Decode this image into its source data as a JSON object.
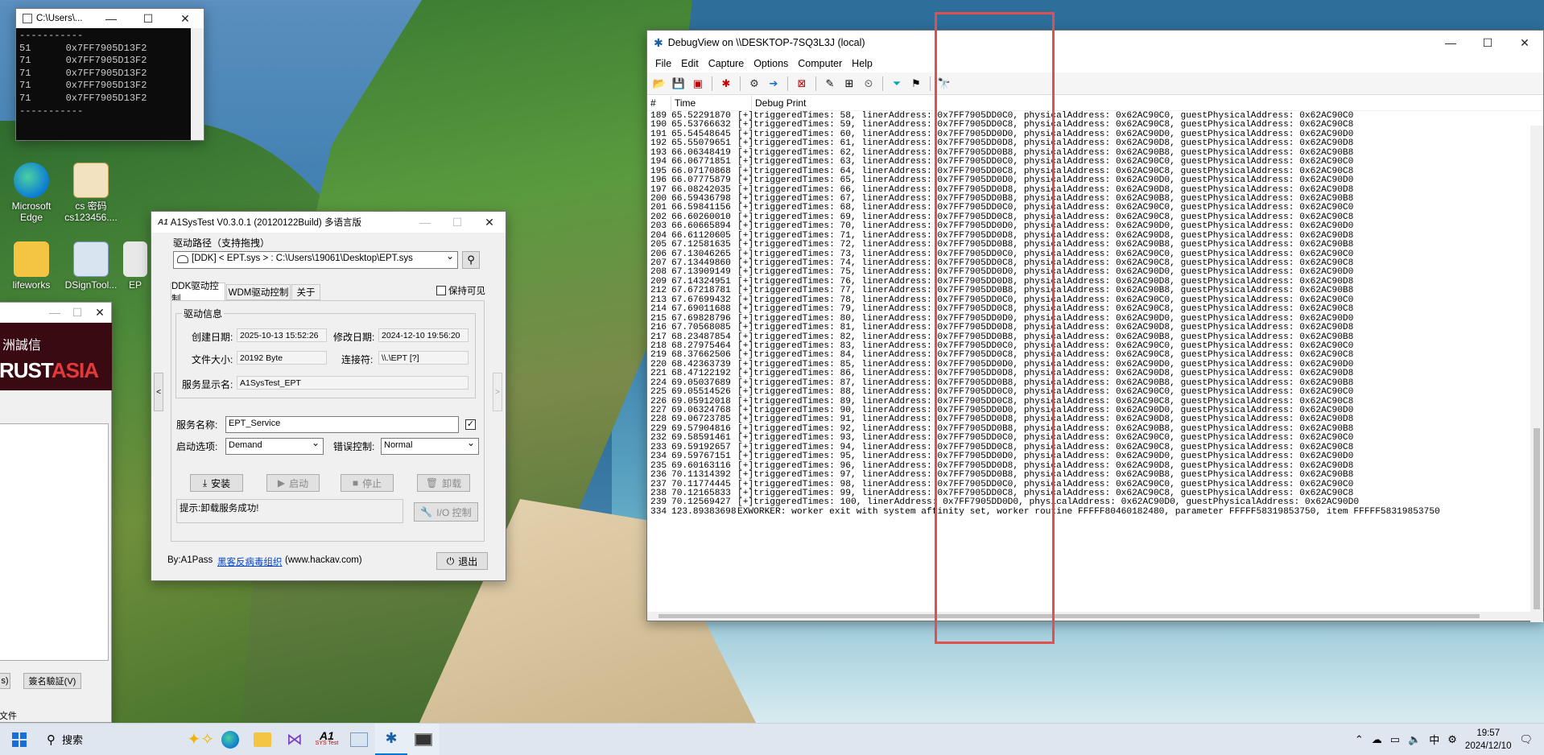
{
  "console": {
    "title": "C:\\Users\\...",
    "lines": [
      "-----------",
      "51      0x7FF7905D13F2",
      "71      0x7FF7905D13F2",
      "71      0x7FF7905D13F2",
      "71      0x7FF7905D13F2",
      "71      0x7FF7905D13F2",
      "-----------"
    ]
  },
  "desktop": {
    "icons": [
      {
        "name": "edge",
        "label": "Microsoft\nEdge"
      },
      {
        "name": "cs",
        "label": "cs 密码\ncs123456...."
      },
      {
        "name": "lifeworks",
        "label": "lifeworks"
      },
      {
        "name": "dsign",
        "label": "DSignTool..."
      },
      {
        "name": "ep",
        "label": "EP"
      }
    ]
  },
  "trustasia": {
    "brand1": "洲誠信",
    "brand2": "RUST",
    "brand3": "ASIA",
    "btn1": "s)",
    "btn2": "簽名驗証(V)",
    "footer": "文件"
  },
  "a1": {
    "title": "A1SysTest V0.3.0.1  (20120122Build) 多语言版",
    "drive_path_label": "驱动路径（支持拖拽）",
    "drive_path": "[DDK] < EPT.sys > :  C:\\Users\\19061\\Desktop\\EPT.sys",
    "tabs": [
      "DDK驱动控制",
      "WDM驱动控制",
      "关于"
    ],
    "keep_visible": "保持可见",
    "info_group": "驱动信息",
    "created_label": "创建日期:",
    "created": "2025-10-13 15:52:26",
    "modified_label": "修改日期:",
    "modified": "2024-12-10 19:56:20",
    "size_label": "文件大小:",
    "size": "20192 Byte",
    "link_label": "连接符:",
    "link": "\\\\.\\EPT  [?]",
    "svc_display_label": "服务显示名:",
    "svc_display": "A1SysTest_EPT",
    "svc_name_label": "服务名称:",
    "svc_name": "EPT_Service",
    "start_label": "启动选项:",
    "start": "Demand",
    "error_label": "错误控制:",
    "error": "Normal",
    "btn_install": "安装",
    "btn_start": "启动",
    "btn_stop": "停止",
    "btn_uninstall": "卸载",
    "hint": "提示:卸载服务成功!",
    "btn_io": "I/O 控制",
    "by": "By:A1Pass",
    "link_text": "黑客反病毒组织",
    "site": "(www.hackav.com)",
    "btn_exit": "退出"
  },
  "debugview": {
    "title": "DebugView on \\\\DESKTOP-7SQ3L3J (local)",
    "menu": [
      "File",
      "Edit",
      "Capture",
      "Options",
      "Computer",
      "Help"
    ],
    "columns": [
      "#",
      "Time",
      "Debug Print"
    ],
    "rows": [
      [
        "189",
        "65.52291870",
        "[+]triggeredTimes: 58, linerAddress: 0x7FF7905DD0C0, physicalAddress: 0x62AC90C0, guestPhysicalAddress: 0x62AC90C0"
      ],
      [
        "190",
        "65.53766632",
        "[+]triggeredTimes: 59, linerAddress: 0x7FF7905DD0C8, physicalAddress: 0x62AC90C8, guestPhysicalAddress: 0x62AC90C8"
      ],
      [
        "191",
        "65.54548645",
        "[+]triggeredTimes: 60, linerAddress: 0x7FF7905DD0D0, physicalAddress: 0x62AC90D0, guestPhysicalAddress: 0x62AC90D0"
      ],
      [
        "192",
        "65.55079651",
        "[+]triggeredTimes: 61, linerAddress: 0x7FF7905DD0D8, physicalAddress: 0x62AC90D8, guestPhysicalAddress: 0x62AC90D8"
      ],
      [
        "193",
        "66.06348419",
        "[+]triggeredTimes: 62, linerAddress: 0x7FF7905DD0B8, physicalAddress: 0x62AC90B8, guestPhysicalAddress: 0x62AC90B8"
      ],
      [
        "194",
        "66.06771851",
        "[+]triggeredTimes: 63, linerAddress: 0x7FF7905DD0C0, physicalAddress: 0x62AC90C0, guestPhysicalAddress: 0x62AC90C0"
      ],
      [
        "195",
        "66.07170868",
        "[+]triggeredTimes: 64, linerAddress: 0x7FF7905DD0C8, physicalAddress: 0x62AC90C8, guestPhysicalAddress: 0x62AC90C8"
      ],
      [
        "196",
        "66.07775879",
        "[+]triggeredTimes: 65, linerAddress: 0x7FF7905DD0D0, physicalAddress: 0x62AC90D0, guestPhysicalAddress: 0x62AC90D0"
      ],
      [
        "197",
        "66.08242035",
        "[+]triggeredTimes: 66, linerAddress: 0x7FF7905DD0D8, physicalAddress: 0x62AC90D8, guestPhysicalAddress: 0x62AC90D8"
      ],
      [
        "200",
        "66.59436798",
        "[+]triggeredTimes: 67, linerAddress: 0x7FF7905DD0B8, physicalAddress: 0x62AC90B8, guestPhysicalAddress: 0x62AC90B8"
      ],
      [
        "201",
        "66.59841156",
        "[+]triggeredTimes: 68, linerAddress: 0x7FF7905DD0C0, physicalAddress: 0x62AC90C0, guestPhysicalAddress: 0x62AC90C0"
      ],
      [
        "202",
        "66.60260010",
        "[+]triggeredTimes: 69, linerAddress: 0x7FF7905DD0C8, physicalAddress: 0x62AC90C8, guestPhysicalAddress: 0x62AC90C8"
      ],
      [
        "203",
        "66.60665894",
        "[+]triggeredTimes: 70, linerAddress: 0x7FF7905DD0D0, physicalAddress: 0x62AC90D0, guestPhysicalAddress: 0x62AC90D0"
      ],
      [
        "204",
        "66.61120605",
        "[+]triggeredTimes: 71, linerAddress: 0x7FF7905DD0D8, physicalAddress: 0x62AC90D8, guestPhysicalAddress: 0x62AC90D8"
      ],
      [
        "205",
        "67.12581635",
        "[+]triggeredTimes: 72, linerAddress: 0x7FF7905DD0B8, physicalAddress: 0x62AC90B8, guestPhysicalAddress: 0x62AC90B8"
      ],
      [
        "206",
        "67.13046265",
        "[+]triggeredTimes: 73, linerAddress: 0x7FF7905DD0C0, physicalAddress: 0x62AC90C0, guestPhysicalAddress: 0x62AC90C0"
      ],
      [
        "207",
        "67.13449860",
        "[+]triggeredTimes: 74, linerAddress: 0x7FF7905DD0C8, physicalAddress: 0x62AC90C8, guestPhysicalAddress: 0x62AC90C8"
      ],
      [
        "208",
        "67.13909149",
        "[+]triggeredTimes: 75, linerAddress: 0x7FF7905DD0D0, physicalAddress: 0x62AC90D0, guestPhysicalAddress: 0x62AC90D0"
      ],
      [
        "209",
        "67.14324951",
        "[+]triggeredTimes: 76, linerAddress: 0x7FF7905DD0D8, physicalAddress: 0x62AC90D8, guestPhysicalAddress: 0x62AC90D8"
      ],
      [
        "212",
        "67.67218781",
        "[+]triggeredTimes: 77, linerAddress: 0x7FF7905DD0B8, physicalAddress: 0x62AC90B8, guestPhysicalAddress: 0x62AC90B8"
      ],
      [
        "213",
        "67.67699432",
        "[+]triggeredTimes: 78, linerAddress: 0x7FF7905DD0C0, physicalAddress: 0x62AC90C0, guestPhysicalAddress: 0x62AC90C0"
      ],
      [
        "214",
        "67.69011688",
        "[+]triggeredTimes: 79, linerAddress: 0x7FF7905DD0C8, physicalAddress: 0x62AC90C8, guestPhysicalAddress: 0x62AC90C8"
      ],
      [
        "215",
        "67.69828796",
        "[+]triggeredTimes: 80, linerAddress: 0x7FF7905DD0D0, physicalAddress: 0x62AC90D0, guestPhysicalAddress: 0x62AC90D0"
      ],
      [
        "216",
        "67.70568085",
        "[+]triggeredTimes: 81, linerAddress: 0x7FF7905DD0D8, physicalAddress: 0x62AC90D8, guestPhysicalAddress: 0x62AC90D8"
      ],
      [
        "217",
        "68.23487854",
        "[+]triggeredTimes: 82, linerAddress: 0x7FF7905DD0B8, physicalAddress: 0x62AC90B8, guestPhysicalAddress: 0x62AC90B8"
      ],
      [
        "218",
        "68.27975464",
        "[+]triggeredTimes: 83, linerAddress: 0x7FF7905DD0C0, physicalAddress: 0x62AC90C0, guestPhysicalAddress: 0x62AC90C0"
      ],
      [
        "219",
        "68.37662506",
        "[+]triggeredTimes: 84, linerAddress: 0x7FF7905DD0C8, physicalAddress: 0x62AC90C8, guestPhysicalAddress: 0x62AC90C8"
      ],
      [
        "220",
        "68.42363739",
        "[+]triggeredTimes: 85, linerAddress: 0x7FF7905DD0D0, physicalAddress: 0x62AC90D0, guestPhysicalAddress: 0x62AC90D0"
      ],
      [
        "221",
        "68.47122192",
        "[+]triggeredTimes: 86, linerAddress: 0x7FF7905DD0D8, physicalAddress: 0x62AC90D8, guestPhysicalAddress: 0x62AC90D8"
      ],
      [
        "224",
        "69.05037689",
        "[+]triggeredTimes: 87, linerAddress: 0x7FF7905DD0B8, physicalAddress: 0x62AC90B8, guestPhysicalAddress: 0x62AC90B8"
      ],
      [
        "225",
        "69.05514526",
        "[+]triggeredTimes: 88, linerAddress: 0x7FF7905DD0C0, physicalAddress: 0x62AC90C0, guestPhysicalAddress: 0x62AC90C0"
      ],
      [
        "226",
        "69.05912018",
        "[+]triggeredTimes: 89, linerAddress: 0x7FF7905DD0C8, physicalAddress: 0x62AC90C8, guestPhysicalAddress: 0x62AC90C8"
      ],
      [
        "227",
        "69.06324768",
        "[+]triggeredTimes: 90, linerAddress: 0x7FF7905DD0D0, physicalAddress: 0x62AC90D0, guestPhysicalAddress: 0x62AC90D0"
      ],
      [
        "228",
        "69.06723785",
        "[+]triggeredTimes: 91, linerAddress: 0x7FF7905DD0D8, physicalAddress: 0x62AC90D8, guestPhysicalAddress: 0x62AC90D8"
      ],
      [
        "229",
        "69.57904816",
        "[+]triggeredTimes: 92, linerAddress: 0x7FF7905DD0B8, physicalAddress: 0x62AC90B8, guestPhysicalAddress: 0x62AC90B8"
      ],
      [
        "232",
        "69.58591461",
        "[+]triggeredTimes: 93, linerAddress: 0x7FF7905DD0C0, physicalAddress: 0x62AC90C0, guestPhysicalAddress: 0x62AC90C0"
      ],
      [
        "233",
        "69.59192657",
        "[+]triggeredTimes: 94, linerAddress: 0x7FF7905DD0C8, physicalAddress: 0x62AC90C8, guestPhysicalAddress: 0x62AC90C8"
      ],
      [
        "234",
        "69.59767151",
        "[+]triggeredTimes: 95, linerAddress: 0x7FF7905DD0D0, physicalAddress: 0x62AC90D0, guestPhysicalAddress: 0x62AC90D0"
      ],
      [
        "235",
        "69.60163116",
        "[+]triggeredTimes: 96, linerAddress: 0x7FF7905DD0D8, physicalAddress: 0x62AC90D8, guestPhysicalAddress: 0x62AC90D8"
      ],
      [
        "236",
        "70.11314392",
        "[+]triggeredTimes: 97, linerAddress: 0x7FF7905DD0B8, physicalAddress: 0x62AC90B8, guestPhysicalAddress: 0x62AC90B8"
      ],
      [
        "237",
        "70.11774445",
        "[+]triggeredTimes: 98, linerAddress: 0x7FF7905DD0C0, physicalAddress: 0x62AC90C0, guestPhysicalAddress: 0x62AC90C0"
      ],
      [
        "238",
        "70.12165833",
        "[+]triggeredTimes: 99, linerAddress: 0x7FF7905DD0C8, physicalAddress: 0x62AC90C8, guestPhysicalAddress: 0x62AC90C8"
      ],
      [
        "239",
        "70.12569427",
        "[+]triggeredTimes: 100, linerAddress: 0x7FF7905DD0D0, physicalAddress: 0x62AC90D0, guestPhysicalAddress: 0x62AC90D0"
      ],
      [
        "334",
        "123.89383698",
        "EXWORKER: worker exit with system affinity set, worker routine FFFFF80460182480, parameter FFFFF58319853750, item FFFFF58319853750"
      ]
    ]
  },
  "taskbar": {
    "search": "搜索",
    "ime": "中",
    "time": "19:57",
    "date": "2024/12/10",
    "a1_label": "SYS Test"
  },
  "colors": {
    "highlight_box": "#e05050",
    "accent": "#0078d4",
    "link": "#0044cc"
  }
}
